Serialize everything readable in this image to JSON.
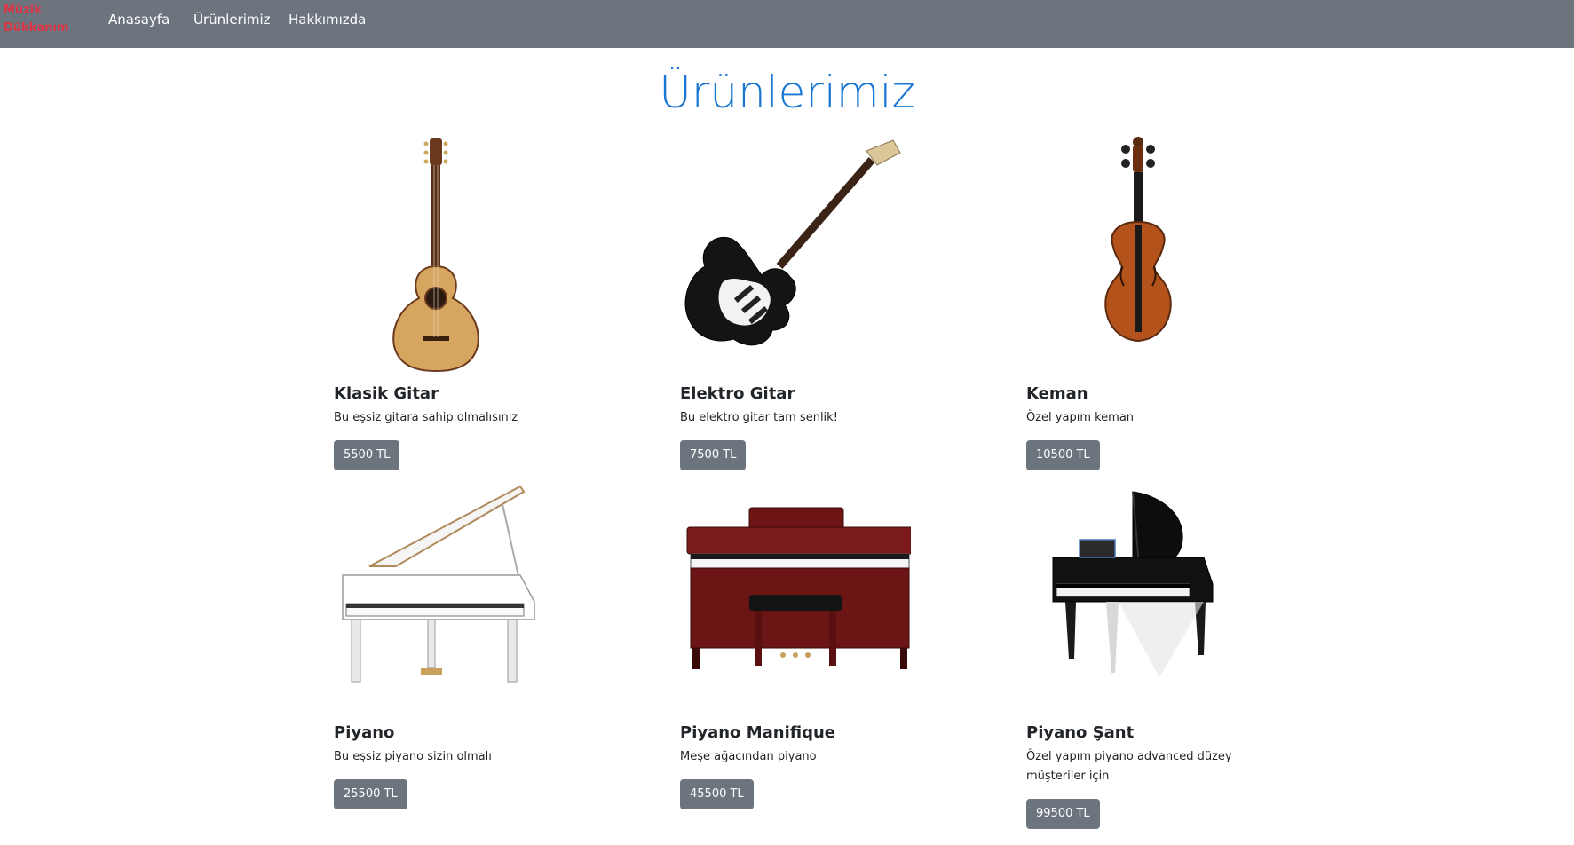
{
  "navbar": {
    "brand": "Müzik Dükkanım",
    "links": [
      "Anasayfa",
      "Ürünlerimiz",
      "Hakkımızda"
    ]
  },
  "page": {
    "title": "Ürünlerimiz"
  },
  "products": [
    {
      "name": "Klasik Gitar",
      "description": "Bu eşsiz gitara sahip olmalısınız",
      "price": "5500 TL",
      "image": "classical-guitar"
    },
    {
      "name": "Elektro Gitar",
      "description": "Bu elektro gitar tam senlik!",
      "price": "7500 TL",
      "image": "electric-guitar"
    },
    {
      "name": "Keman",
      "description": "Özel yapım keman",
      "price": "10500 TL",
      "image": "violin"
    },
    {
      "name": "Piyano",
      "description": "Bu eşsiz piyano sizin olmalı",
      "price": "25500 TL",
      "image": "white-grand-piano"
    },
    {
      "name": "Piyano Manifique",
      "description": "Meşe ağacından piyano",
      "price": "45500 TL",
      "image": "upright-piano"
    },
    {
      "name": "Piyano Şant",
      "description": "Özel yapım piyano advanced düzey müşteriler için",
      "price": "99500 TL",
      "image": "black-grand-piano"
    }
  ],
  "colors": {
    "navbar_bg": "#6c757d",
    "brand": "#dc3545",
    "title": "#1976d2",
    "button_bg": "#6c757d"
  }
}
